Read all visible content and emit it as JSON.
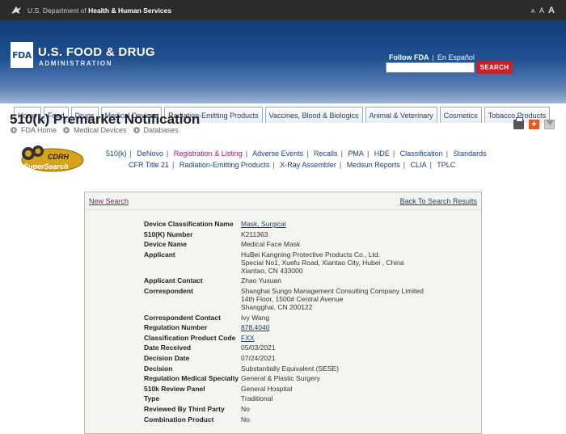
{
  "hhs": {
    "prefix": "U.S. Department of ",
    "bold": "Health & Human Services",
    "text_size": [
      "A",
      "A",
      "A"
    ]
  },
  "fda": {
    "logo": "FDA",
    "title": "U.S. FOOD & DRUG",
    "subtitle": "ADMINISTRATION",
    "follow": "Follow FDA",
    "espanol": "En Español",
    "search_label": "SEARCH"
  },
  "nav": [
    "Home",
    "Food",
    "Drugs",
    "Medical Devices",
    "Radiation-Emitting Products",
    "Vaccines, Blood & Biologics",
    "Animal & Veterinary",
    "Cosmetics",
    "Tobacco Products"
  ],
  "page": {
    "title": "510(k) Premarket Notification",
    "breadcrumb": [
      "FDA Home",
      "Medical Devices",
      "Databases"
    ]
  },
  "cdrh": {
    "line1": "CDRH",
    "line2": "SuperSearch"
  },
  "links": {
    "row1": [
      "510(k)",
      "DeNovo",
      "Registration & Listing",
      "Adverse Events",
      "Recalls",
      "PMA",
      "HDE",
      "Classification",
      "Standards"
    ],
    "row2": [
      "CFR Title 21",
      "Radiation-Emitting Products",
      "X-Ray Assembler",
      "Medsun Reports",
      "CLIA",
      "TPLC"
    ]
  },
  "panel": {
    "new_search": "New Search",
    "back": "Back To Search Results",
    "rows": [
      {
        "label": "Device Classification Name",
        "value": "Mask, Surgical",
        "link": true
      },
      {
        "label": "510(K) Number",
        "value": "K211363"
      },
      {
        "label": "Device Name",
        "value": "Medical Face Mask"
      },
      {
        "label": "Applicant",
        "lines": [
          "HuBei Kangning Protective Products Co., Ltd.",
          "Special No1, Xuefu Road, Xiantao City, Hubei , China",
          "Xiantao,  CN 433000"
        ]
      },
      {
        "label": "Applicant Contact",
        "value": "Zhao Yuxuan"
      },
      {
        "label": "Correspondent",
        "lines": [
          "Shanghai Sungo Management Consulting Company Limited",
          "14th Floor, 1500# Central Avenue",
          "Shangghai,  CN 200122"
        ]
      },
      {
        "label": "Correspondent Contact",
        "value": "Ivy Wang"
      },
      {
        "label": "Regulation Number",
        "value": "878.4040",
        "link": true
      },
      {
        "label": "Classification Product Code",
        "value": "FXX",
        "link": true
      },
      {
        "label": "Date Received",
        "value": "05/03/2021"
      },
      {
        "label": "Decision Date",
        "value": "07/24/2021"
      },
      {
        "label": "Decision",
        "value": "Substantially Equivalent (SESE)"
      },
      {
        "label": "Regulation Medical Specialty",
        "value": "General & Plastic Surgery"
      },
      {
        "label": "510k Review Panel",
        "value": "General Hospital"
      },
      {
        "label": "Type",
        "value": "Traditional"
      },
      {
        "label": "Reviewed By Third Party",
        "value": "No"
      },
      {
        "label": "Combination Product",
        "value": "No"
      }
    ]
  }
}
